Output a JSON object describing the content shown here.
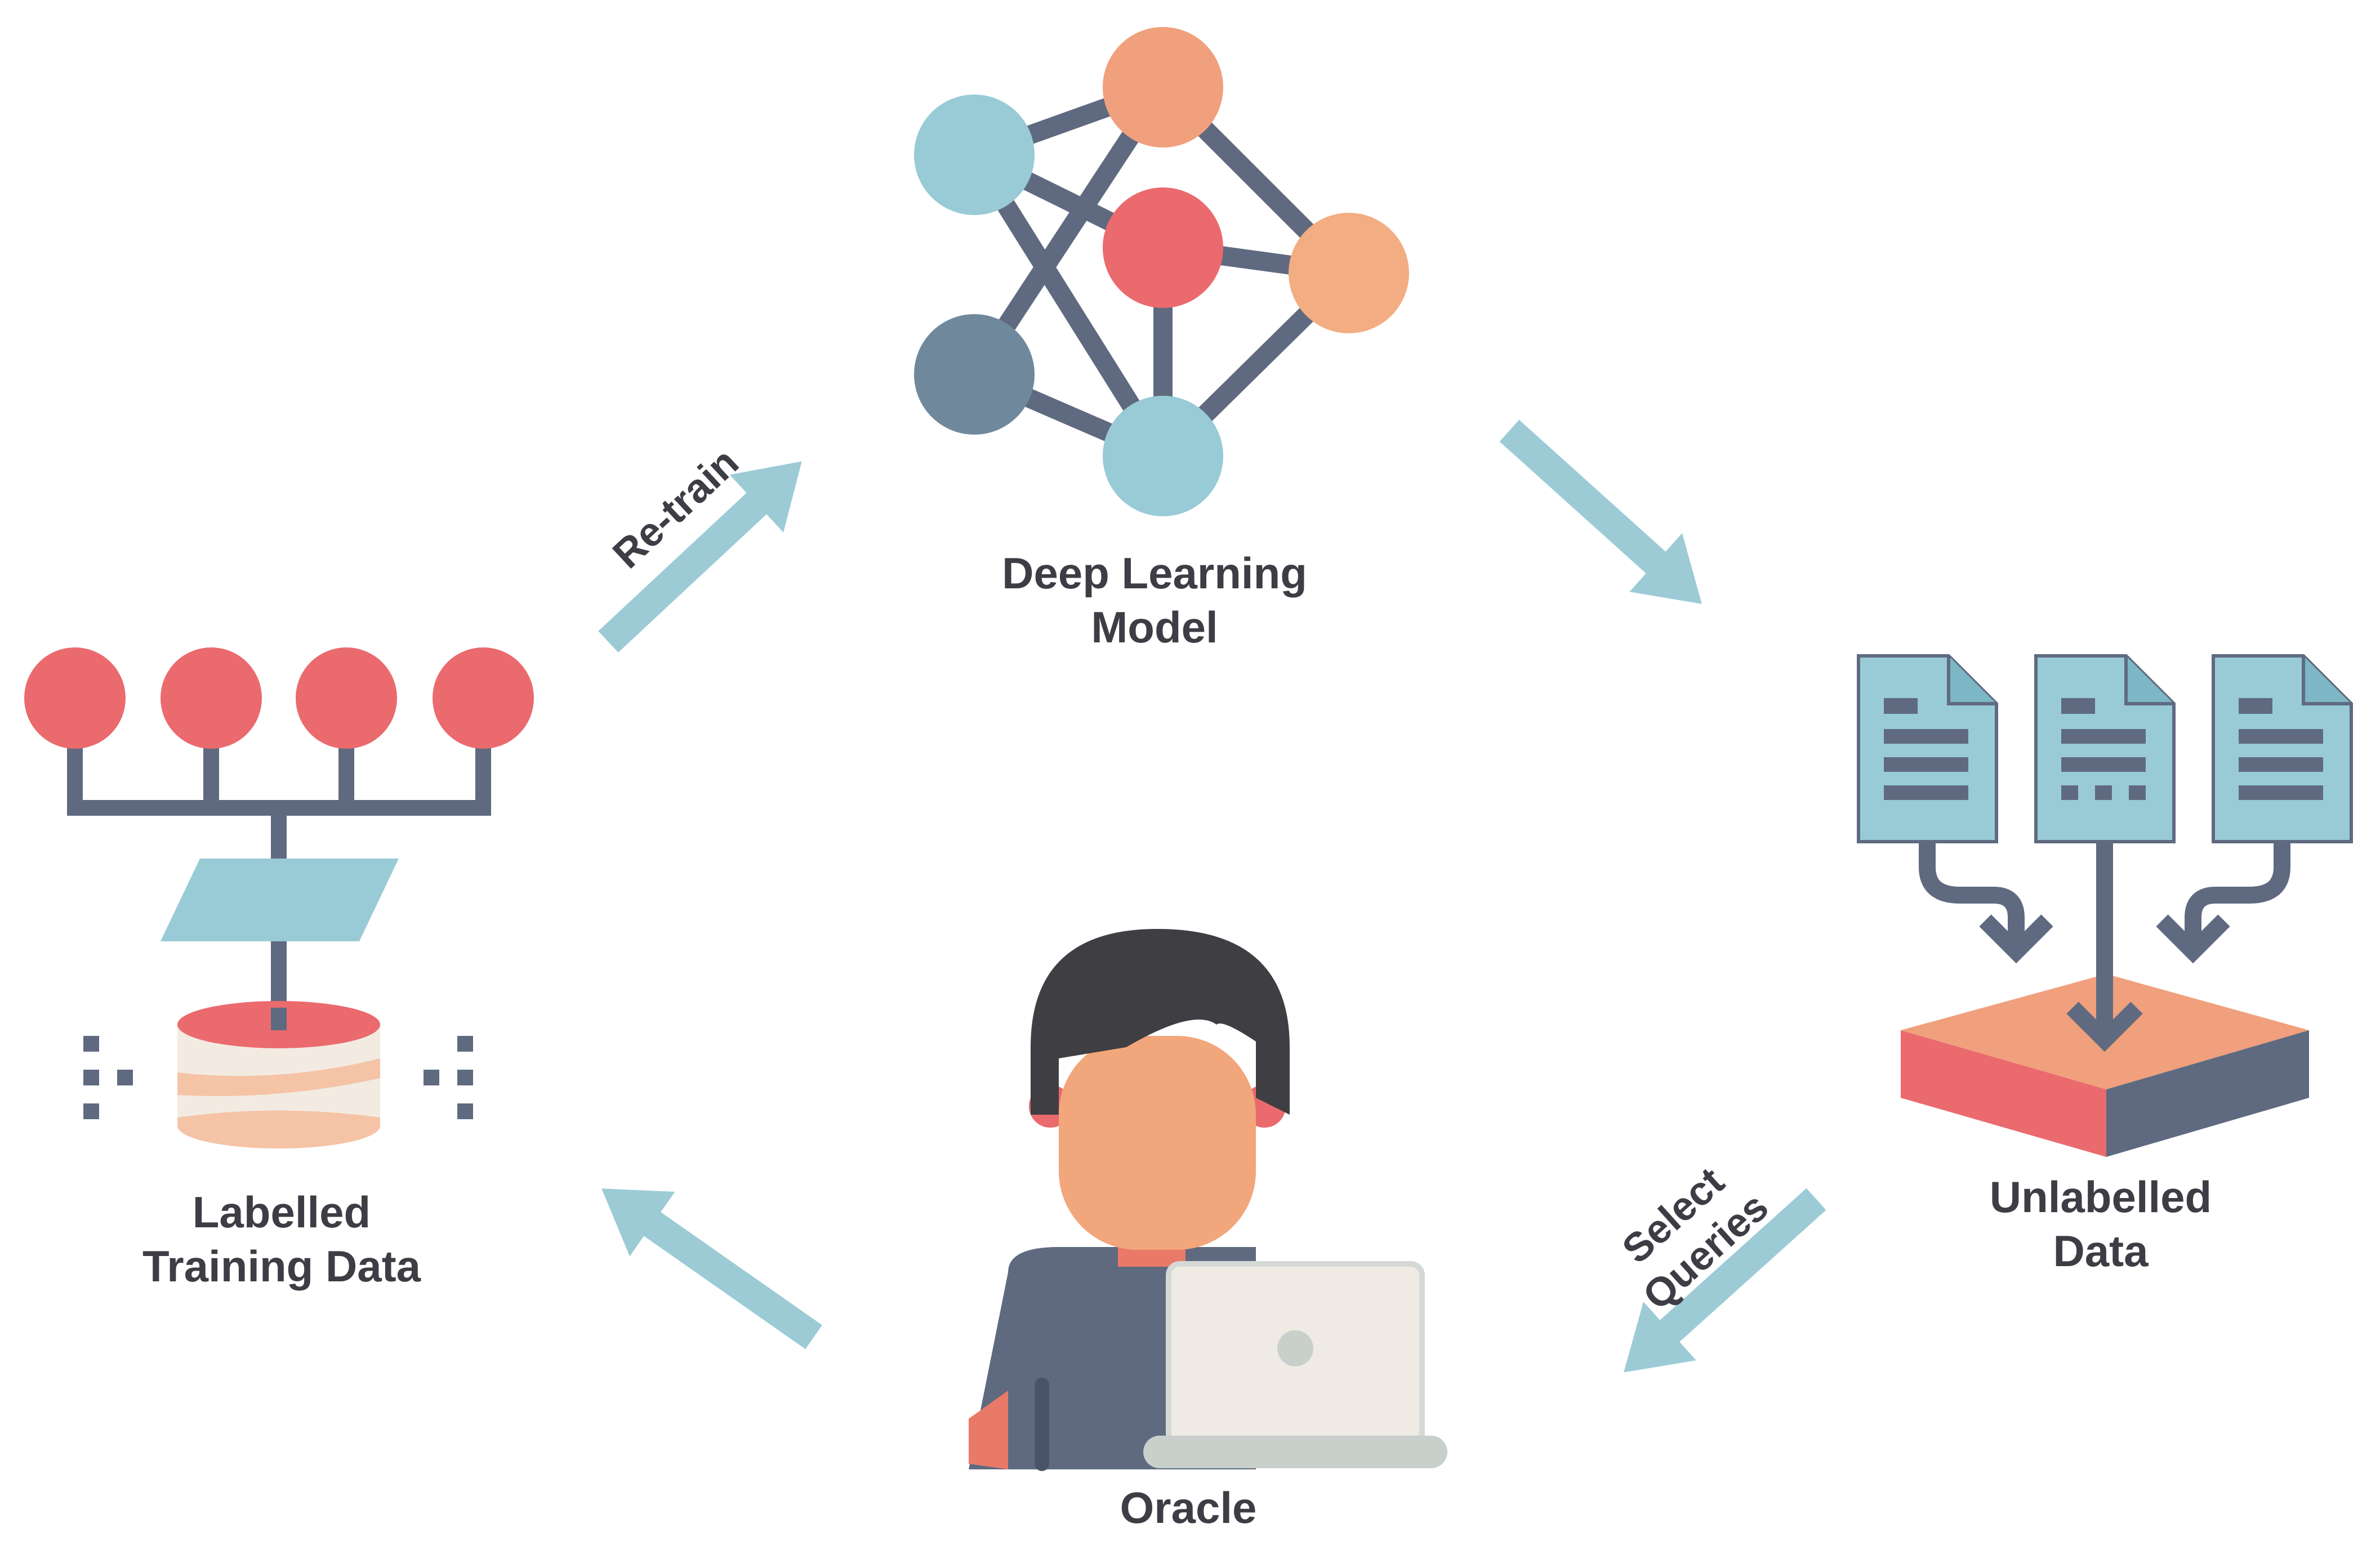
{
  "labels": {
    "model_line1": "Deep Learning",
    "model_line2": "Model",
    "unlabelled_line1": "Unlabelled",
    "unlabelled_line2": "Data",
    "oracle": "Oracle",
    "labelled_line1": "Labelled",
    "labelled_line2": "Training Data",
    "retrain": "Re-train",
    "select_line1": "Select",
    "select_line2": "Queries"
  },
  "colors": {
    "arrow": "#9ccbd6",
    "dark_slate": "#5f6a80",
    "coral": "#ea6a6e",
    "peach": "#f2a17a",
    "light_blue": "#98cbd6",
    "text": "#3d3d45"
  },
  "icons": {
    "model": "neural-network-icon",
    "unlabelled": "documents-to-tray-icon",
    "oracle": "person-with-laptop-icon",
    "labelled": "labelled-database-tree-icon"
  }
}
